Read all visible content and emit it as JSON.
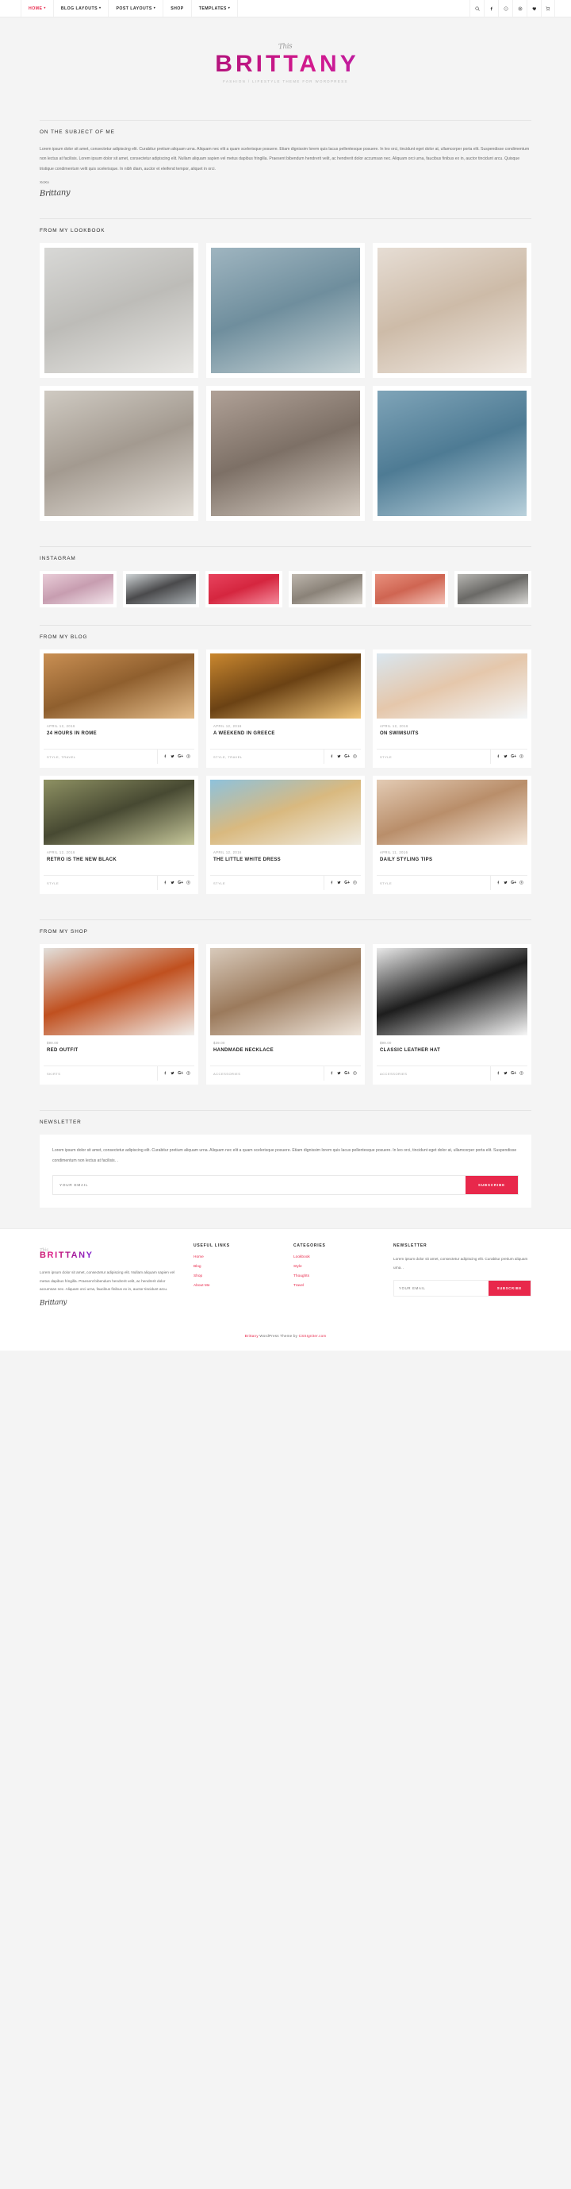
{
  "nav": {
    "items": [
      {
        "label": "HOME",
        "caret": true,
        "active": true
      },
      {
        "label": "BLOG LAYOUTS",
        "caret": true,
        "active": false
      },
      {
        "label": "POST LAYOUTS",
        "caret": true,
        "active": false
      },
      {
        "label": "SHOP",
        "caret": false,
        "active": false
      },
      {
        "label": "TEMPLATES",
        "caret": true,
        "active": false
      }
    ],
    "icons": [
      "search-icon",
      "facebook-icon",
      "twitter-icon",
      "instagram-icon",
      "heart-icon",
      "cart-icon"
    ]
  },
  "logo": {
    "script": "This",
    "main": "BRITTANY",
    "tagline": "FASHION / LIFESTYLE THEME FOR WORDPRESS"
  },
  "about": {
    "heading": "ON THE SUBJECT OF ME",
    "body": "Lorem ipsum dolor sit amet, consectetur adipiscing elit. Curabitur pretium aliquam urna. Aliquam nec elit a quam scelerisque posuere. Etiam dignissim lorem quis lacus pellentesque posuere. In leo orci, tincidunt eget dolor at, ullamcorper porta elit. Suspendisse condimentum non lectus at facilisis. Lorem ipsum dolor sit amet, consectetur adipiscing elit. Nullam aliquam sapien vel metus dapibus fringilla. Praesent bibendum hendrerit velit, ac hendrerit dolor accumsan nec. Aliquam orci urna, faucibus finibus ex in, auctor tincidunt arcu. Quisque tristique condimentum velit quis scelerisque. In nibh diam, auctor et eleifend tempor, aliquet in orci.",
    "xoxo": "XoXo",
    "signature": "Brittany"
  },
  "lookbook": {
    "heading": "FROM MY LOOKBOOK",
    "items": [
      {
        "name": "lookbook-photo-1",
        "colors": [
          "#d8d8d6",
          "#bdbcb8",
          "#e7e6e3"
        ]
      },
      {
        "name": "lookbook-photo-2",
        "colors": [
          "#9fb5c0",
          "#6f8e9d",
          "#c6d3d6"
        ]
      },
      {
        "name": "lookbook-photo-3",
        "colors": [
          "#e6ddd4",
          "#cdbba8",
          "#f0e9e2"
        ]
      },
      {
        "name": "lookbook-photo-4",
        "colors": [
          "#cfcac2",
          "#a39a90",
          "#e3ded7"
        ]
      },
      {
        "name": "lookbook-photo-5",
        "colors": [
          "#b0a197",
          "#7d7066",
          "#d6cdc3"
        ]
      },
      {
        "name": "lookbook-photo-6",
        "colors": [
          "#7fa4b8",
          "#4e7b94",
          "#b9d1dc"
        ]
      }
    ]
  },
  "instagram": {
    "heading": "INSTAGRAM",
    "items": [
      {
        "name": "instagram-photo-1",
        "colors": [
          "#e9cdd8",
          "#c79db0",
          "#f2e4ea"
        ]
      },
      {
        "name": "instagram-photo-2",
        "colors": [
          "#cfd4d6",
          "#4a4a4c",
          "#a8aeb1"
        ]
      },
      {
        "name": "instagram-photo-3",
        "colors": [
          "#e8435e",
          "#d5263f",
          "#f48a9b"
        ]
      },
      {
        "name": "instagram-photo-4",
        "colors": [
          "#bdb6ad",
          "#8a8278",
          "#ddd8d1"
        ]
      },
      {
        "name": "instagram-photo-5",
        "colors": [
          "#e8907d",
          "#cf6552",
          "#f3c1b6"
        ]
      },
      {
        "name": "instagram-photo-6",
        "colors": [
          "#b7b6b2",
          "#6a6966",
          "#d8d7d4"
        ]
      }
    ]
  },
  "blog": {
    "heading": "FROM MY BLOG",
    "posts": [
      {
        "date": "APRIL 12, 2016",
        "title": "24 HOURS IN ROME",
        "cats": "STYLE, TRAVEL",
        "colors": [
          "#c98f53",
          "#8f5f2e",
          "#e4bd8b"
        ]
      },
      {
        "date": "APRIL 12, 2016",
        "title": "A WEEKEND IN GREECE",
        "cats": "STYLE, TRAVEL",
        "colors": [
          "#c9872f",
          "#6b4214",
          "#f0c57a"
        ]
      },
      {
        "date": "APRIL 12, 2016",
        "title": "ON SWIMSUITS",
        "cats": "STYLE",
        "colors": [
          "#d9e6ef",
          "#e5c7ab",
          "#f3f6f8"
        ]
      },
      {
        "date": "APRIL 12, 2016",
        "title": "RETRO IS THE NEW BLACK",
        "cats": "STYLE",
        "colors": [
          "#8e9163",
          "#474932",
          "#c6c79a"
        ]
      },
      {
        "date": "APRIL 12, 2016",
        "title": "THE LITTLE WHITE DRESS",
        "cats": "STYLE",
        "colors": [
          "#8ec2dc",
          "#d9b97f",
          "#f0ece2"
        ]
      },
      {
        "date": "APRIL 11, 2016",
        "title": "DAILY STYLING TIPS",
        "cats": "STYLE",
        "colors": [
          "#e3cbb4",
          "#b98e6a",
          "#f4e6d8"
        ]
      }
    ],
    "share_icons": [
      "facebook-icon",
      "twitter-icon",
      "google-plus-icon",
      "pinterest-icon"
    ]
  },
  "shop": {
    "heading": "FROM MY SHOP",
    "products": [
      {
        "price": "$99.00",
        "title": "RED OUTFIT",
        "cats": "SKIRTS",
        "colors": [
          "#e2e0dc",
          "#c0501f",
          "#f1efec"
        ]
      },
      {
        "price": "$39.00",
        "title": "HANDMADE NECKLACE",
        "cats": "ACCESSORIES",
        "colors": [
          "#d8cabb",
          "#9b7a5c",
          "#efe6dc"
        ]
      },
      {
        "price": "$99.00",
        "title": "CLASSIC LEATHER HAT",
        "cats": "ACCESSORIES",
        "colors": [
          "#e9e9e9",
          "#1d1d1d",
          "#f7f7f7"
        ]
      }
    ]
  },
  "newsletter": {
    "heading": "NEWSLETTER",
    "body": "Lorem ipsum dolor sit amet, consectetur adipiscing elit. Curabitur pretium aliquam urna. Aliquam nec elit a quam scelerisque posuere. Etiam dignissim lorem quis lacus pellentesque posuere. In leo orci, tincidunt eget dolor at, ullamcorper porta elit. Suspendisse condimentum non lectus at facilisis. .",
    "placeholder": "YOUR EMAIL",
    "button": "SUBSCRIBE"
  },
  "footer": {
    "logo_script": "This",
    "logo_main": "BRITTANY",
    "about": "Lorem ipsum dolor sit amet, consectetur adipiscing elit. Nullam aliquam sapien vel metus dapibus fringilla. Praesent bibendum hendrerit velit, ac hendrerit dolor accumsan nec. Aliquam orci urna, faucibus finibus ex in, auctor tincidunt arcu.",
    "signature": "Brittany",
    "useful_links": {
      "heading": "USEFUL LINKS",
      "links": [
        "Home",
        "Blog",
        "Shop",
        "About Me"
      ]
    },
    "categories": {
      "heading": "CATEGORIES",
      "links": [
        "Lookbook",
        "Style",
        "Thoughts",
        "Travel"
      ]
    },
    "newsletter": {
      "heading": "NEWSLETTER",
      "body": "Lorem ipsum dolor sit amet, consectetur adipiscing elit. Curabitur pretium aliquam urna. .",
      "placeholder": "YOUR EMAIL",
      "button": "SUBSCRIBE"
    },
    "copyright_pre": "Brittany",
    "copyright_mid": " WordPress Theme by ",
    "copyright_link": "CSSIgniter.com"
  },
  "colors": {
    "accent": "#e8284b",
    "brand_pink": "#c2186e",
    "brand_purple": "#7a22d6",
    "text_dark": "#1f1f1f",
    "text_muted": "#a0a0a0",
    "page_bg": "#f4f4f4"
  }
}
